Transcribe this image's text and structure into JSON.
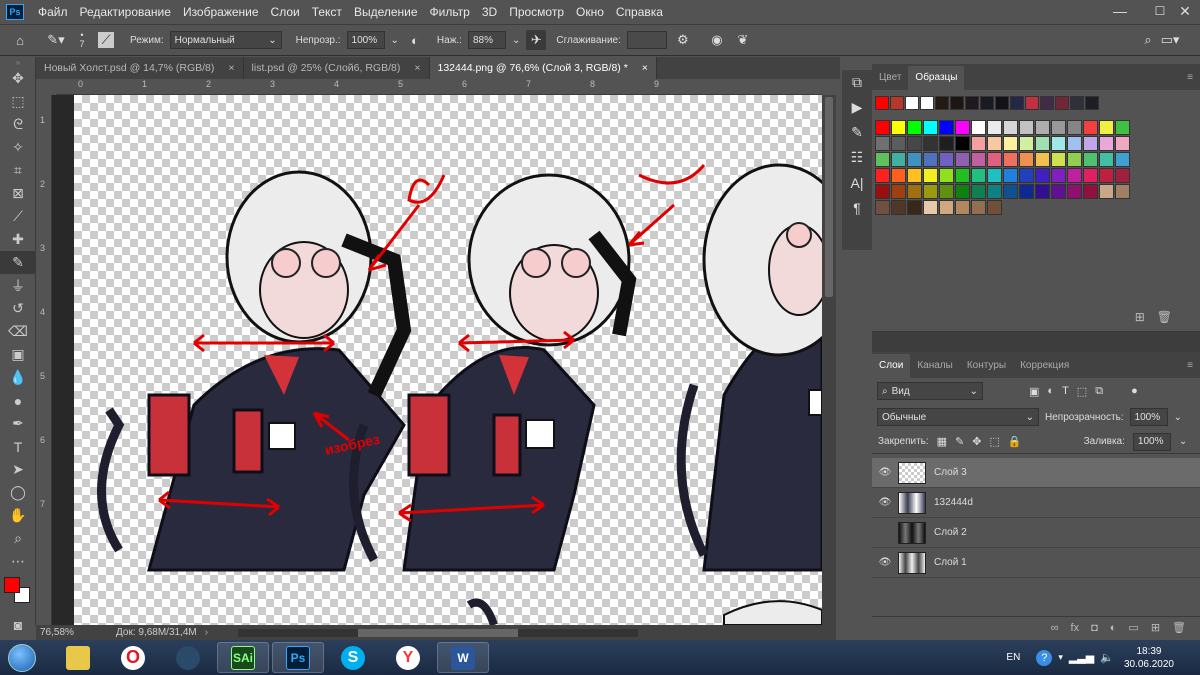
{
  "menubar": {
    "logo": "Ps",
    "items": [
      "Файл",
      "Редактирование",
      "Изображение",
      "Слои",
      "Текст",
      "Выделение",
      "Фильтр",
      "3D",
      "Просмотр",
      "Окно",
      "Справка"
    ],
    "controls": [
      "—",
      "☐",
      "✕"
    ]
  },
  "options": {
    "brush_size": "7",
    "mode_label": "Режим:",
    "mode_value": "Нормальный",
    "opacity_label": "Непрозр.:",
    "opacity_value": "100%",
    "pressure_label": "Наж.:",
    "pressure_value": "88%",
    "smoothing_label": "Сглаживание:",
    "smoothing_value": ""
  },
  "tabs": [
    {
      "label": "Новый Холст.psd @ 14,7% (RGB/8)",
      "close": "×"
    },
    {
      "label": "list.psd @ 25% (Слой6, RGB/8)",
      "close": "×"
    },
    {
      "label": "132444.png @ 76,6% (Слой 3, RGB/8) *",
      "close": "×"
    }
  ],
  "ruler": {
    "top": [
      "0",
      "1",
      "2",
      "3",
      "4",
      "5",
      "6",
      "7",
      "8",
      "9"
    ],
    "left": [
      "1",
      "2",
      "3",
      "4",
      "5",
      "6",
      "7"
    ]
  },
  "status": {
    "zoom": "76,58%",
    "doc": "Док: 9,68М/31,4М"
  },
  "canvas": {
    "annotation": "изобрез"
  },
  "swatch_panel": {
    "tabs": [
      "Цвет",
      "Образцы"
    ],
    "recent": [
      "#ff0000",
      "#b5382a",
      "#ffffff",
      "#ffffff",
      "#241a14",
      "#1c1614",
      "#201820",
      "#1a1a22",
      "#121218",
      "#252845",
      "#c03040",
      "#402c48",
      "#702838",
      "#30303a",
      "#1e1e28"
    ],
    "grid": [
      [
        "#ff0000",
        "#ffff00",
        "#00ff00",
        "#00ffff",
        "#0000ff",
        "#ff00ff",
        "#ffffff",
        "#ebebeb",
        "#d6d6d6",
        "#c2c2c2",
        "#adadad",
        "#999999",
        "#858585",
        "#f04040",
        "#f0f040",
        "#40c040"
      ],
      [
        "#707070",
        "#5c5c5c",
        "#474747",
        "#333333",
        "#1f1f1f",
        "#000000",
        "#f4a0a0",
        "#f8c8a0",
        "#fff0a0",
        "#d0f0a0",
        "#a0e0b0",
        "#a0e8e8",
        "#a0c0f0",
        "#c0a8e8",
        "#e8a8d8",
        "#f0a8c0"
      ],
      [
        "#60c060",
        "#40b0a0",
        "#4090c0",
        "#5070c0",
        "#7060c0",
        "#9060b0",
        "#c060a0",
        "#e06080",
        "#f07060",
        "#f09050",
        "#f0c050",
        "#d0e050",
        "#90d050",
        "#50c070",
        "#40c0a0",
        "#40a0d0"
      ],
      [
        "#ff2020",
        "#ff6020",
        "#ffc020",
        "#f0f020",
        "#90e020",
        "#20c020",
        "#20c080",
        "#20c0c0",
        "#2080e0",
        "#2040c0",
        "#4020c0",
        "#8020c0",
        "#c020a0",
        "#e02060",
        "#c02040",
        "#a02040"
      ],
      [
        "#9a1010",
        "#a04010",
        "#a07010",
        "#9a9a10",
        "#609010",
        "#108010",
        "#108050",
        "#108080",
        "#105090",
        "#102890",
        "#301090",
        "#601090",
        "#901070",
        "#901040",
        "#c8a888",
        "#a08060"
      ],
      [
        "#705040",
        "#503828",
        "#382818",
        "#e8c8a8",
        "#d0a880",
        "#b08860",
        "#907050",
        "#705038"
      ]
    ]
  },
  "layers_panel": {
    "tabs": [
      "Слои",
      "Каналы",
      "Контуры",
      "Коррекция"
    ],
    "filter": "Вид",
    "blend": "Обычные",
    "opacity_label": "Непрозрачность:",
    "opacity_value": "100%",
    "lock_label": "Закрепить:",
    "fill_label": "Заливка:",
    "fill_value": "100%",
    "layers": [
      {
        "name": "Слой 3",
        "visible": true,
        "selected": true
      },
      {
        "name": "132444d",
        "visible": true,
        "selected": false
      },
      {
        "name": "Слой 2",
        "visible": false,
        "selected": false
      },
      {
        "name": "Слой 1",
        "visible": true,
        "selected": false
      }
    ]
  },
  "taskbar": {
    "apps": [
      "explorer",
      "opera",
      "network",
      "SAi",
      "Ps",
      "S",
      "Y",
      "W"
    ],
    "lang": "EN",
    "time": "18:39",
    "date": "30.06.2020"
  }
}
